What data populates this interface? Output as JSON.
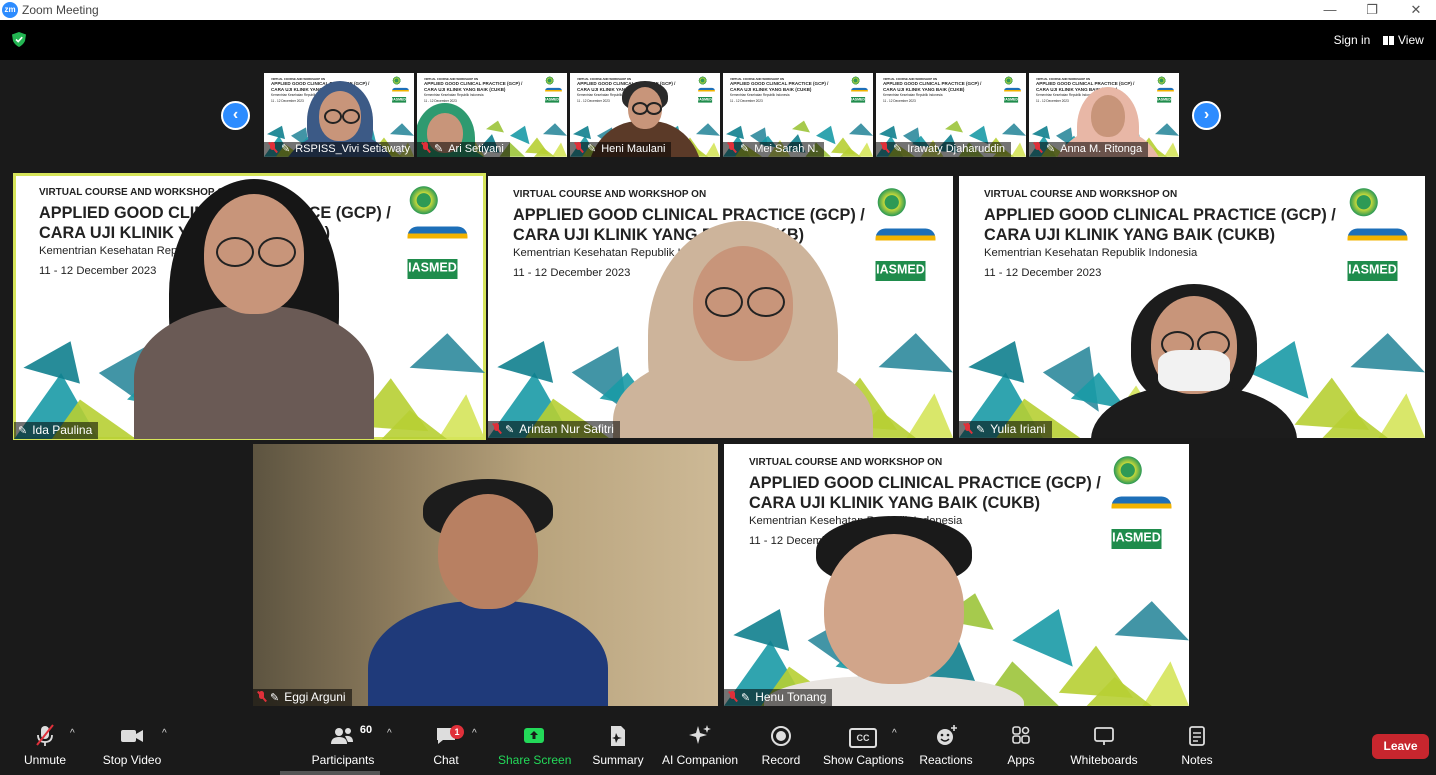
{
  "window": {
    "title": "Zoom Meeting",
    "logo_text": "zm",
    "minimize": "—",
    "restore": "❐",
    "close": "✕"
  },
  "top_bar": {
    "sign_in": "Sign in",
    "view": "View"
  },
  "strip": {
    "prev": "‹",
    "next": "›",
    "thumbs": [
      {
        "name": "RSPISS_Vivi Setiawaty"
      },
      {
        "name": "Ari Setiyani"
      },
      {
        "name": "Heni Maulani"
      },
      {
        "name": "Mei Sarah N."
      },
      {
        "name": "Irawaty Djaharuddin"
      },
      {
        "name": "Anna M. Ritonga"
      }
    ]
  },
  "slide": {
    "line1": "VIRTUAL COURSE AND WORKSHOP ON",
    "line2": "APPLIED GOOD CLINICAL PRACTICE (GCP) /",
    "line3": "CARA UJI KLINIK YANG BAIK (CUKB)",
    "line4": "Kementrian Kesehatan Republik Indonesia",
    "line5": "11 - 12 December 2023",
    "logo_ias": "IASMED"
  },
  "tiles": [
    {
      "name": "Ida Paulina"
    },
    {
      "name": "Arintan Nur Safitri"
    },
    {
      "name": "Yulia Iriani"
    },
    {
      "name": "Eggi Arguni"
    },
    {
      "name": "Henu Tonang"
    }
  ],
  "toolbar": {
    "unmute": "Unmute",
    "stop_video": "Stop Video",
    "participants": "Participants",
    "participants_count": "60",
    "chat": "Chat",
    "chat_badge": "1",
    "share_screen": "Share Screen",
    "summary": "Summary",
    "ai_companion": "AI Companion",
    "record": "Record",
    "show_captions": "Show Captions",
    "cc": "CC",
    "reactions": "Reactions",
    "apps": "Apps",
    "whiteboards": "Whiteboards",
    "notes": "Notes",
    "leave": "Leave",
    "caret": "^"
  },
  "colors": {
    "accent": "#2d8cff",
    "leave": "#c7262e",
    "share": "#23d959",
    "active_speaker": "#d6e45a"
  }
}
